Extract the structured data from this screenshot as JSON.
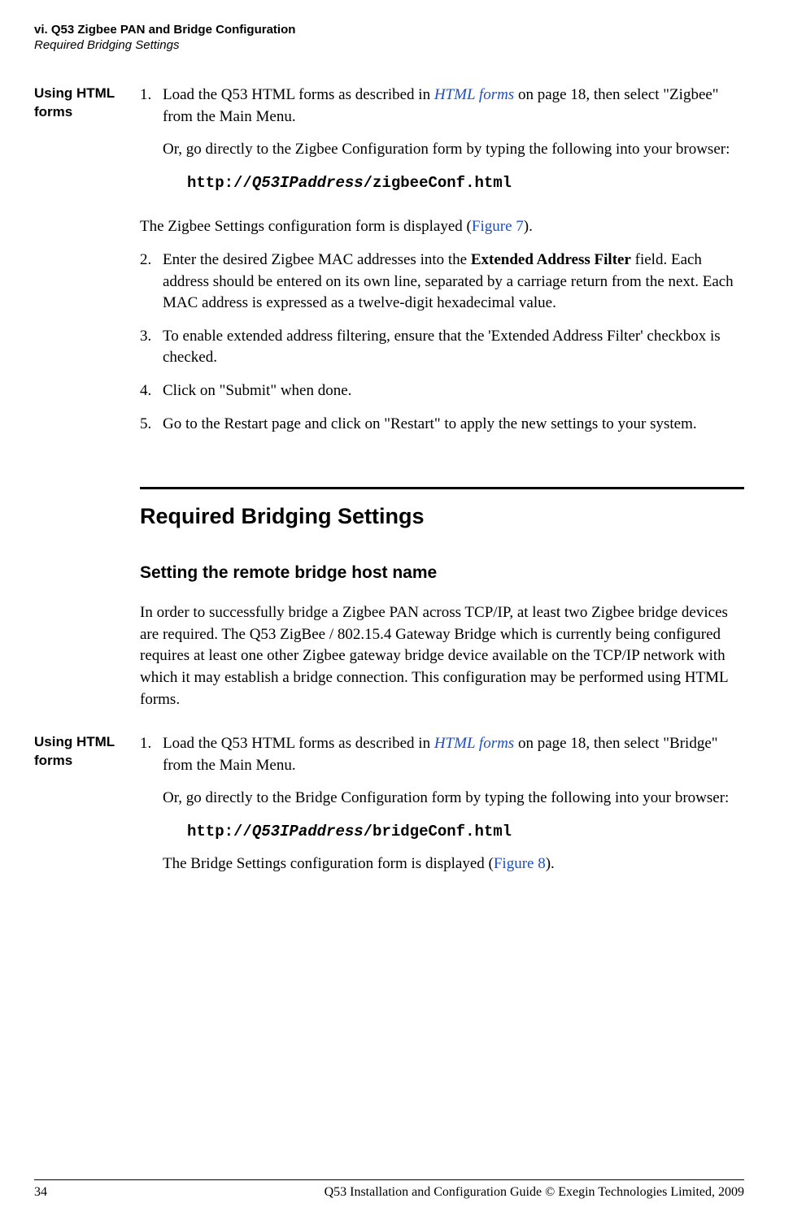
{
  "header": {
    "line1": "vi. Q53 Zigbee PAN and Bridge Configuration",
    "line2": "Required Bridging Settings"
  },
  "section1": {
    "side_label": "Using HTML forms",
    "step1": {
      "num": "1.",
      "text_pre": "Load the Q53 HTML forms as described in ",
      "link": "HTML forms",
      "text_post": " on page 18, then select \"Zigbee\" from the Main Menu.",
      "sub": "Or, go directly to the Zigbee Configuration form by typing the following into your browser:",
      "code_pre": "http://",
      "code_it": "Q53IPaddress",
      "code_post": "/zigbeeConf.html",
      "after_pre": "The Zigbee Settings configuration form is displayed (",
      "after_link": "Figure 7",
      "after_post": ")."
    },
    "step2": {
      "num": "2.",
      "text_pre": "Enter the desired Zigbee MAC addresses into the ",
      "bold": "Extended Address Filter",
      "text_post": " field. Each address should be entered on its own line, separated by a carriage return from the next. Each MAC address is expressed as a twelve-digit hexadecimal value."
    },
    "step3": {
      "num": "3.",
      "text": "To enable extended address filtering, ensure that the 'Extended Address Filter' checkbox is checked."
    },
    "step4": {
      "num": "4.",
      "text": "Click on \"Submit\" when done."
    },
    "step5": {
      "num": "5.",
      "text": "Go to the Restart page and click on \"Restart\" to apply the new settings to your system."
    }
  },
  "h2": "Required Bridging Settings",
  "h3": "Setting the remote bridge host name",
  "body_para": "In order to successfully bridge a Zigbee PAN across TCP/IP, at least two Zigbee bridge devices are required. The Q53 ZigBee / 802.15.4 Gateway Bridge which is currently being configured requires at least one other Zigbee gateway bridge device available on the TCP/IP network with which it may establish a bridge connection. This configuration may be performed using HTML forms.",
  "section2": {
    "side_label": "Using HTML forms",
    "step1": {
      "num": "1.",
      "text_pre": "Load the Q53 HTML forms as described in ",
      "link": "HTML forms",
      "text_post": " on page 18, then select \"Bridge\" from the Main Menu.",
      "sub": "Or, go directly to the Bridge Configuration form by typing the following into your browser:",
      "code_pre": "http://",
      "code_it": "Q53IPaddress",
      "code_post": "/bridgeConf.html",
      "after_pre": "The Bridge Settings configuration form is displayed (",
      "after_link": "Figure 8",
      "after_post": ")."
    }
  },
  "footer": {
    "page": "34",
    "text": "Q53 Installation and Configuration Guide  © Exegin Technologies Limited, 2009"
  }
}
